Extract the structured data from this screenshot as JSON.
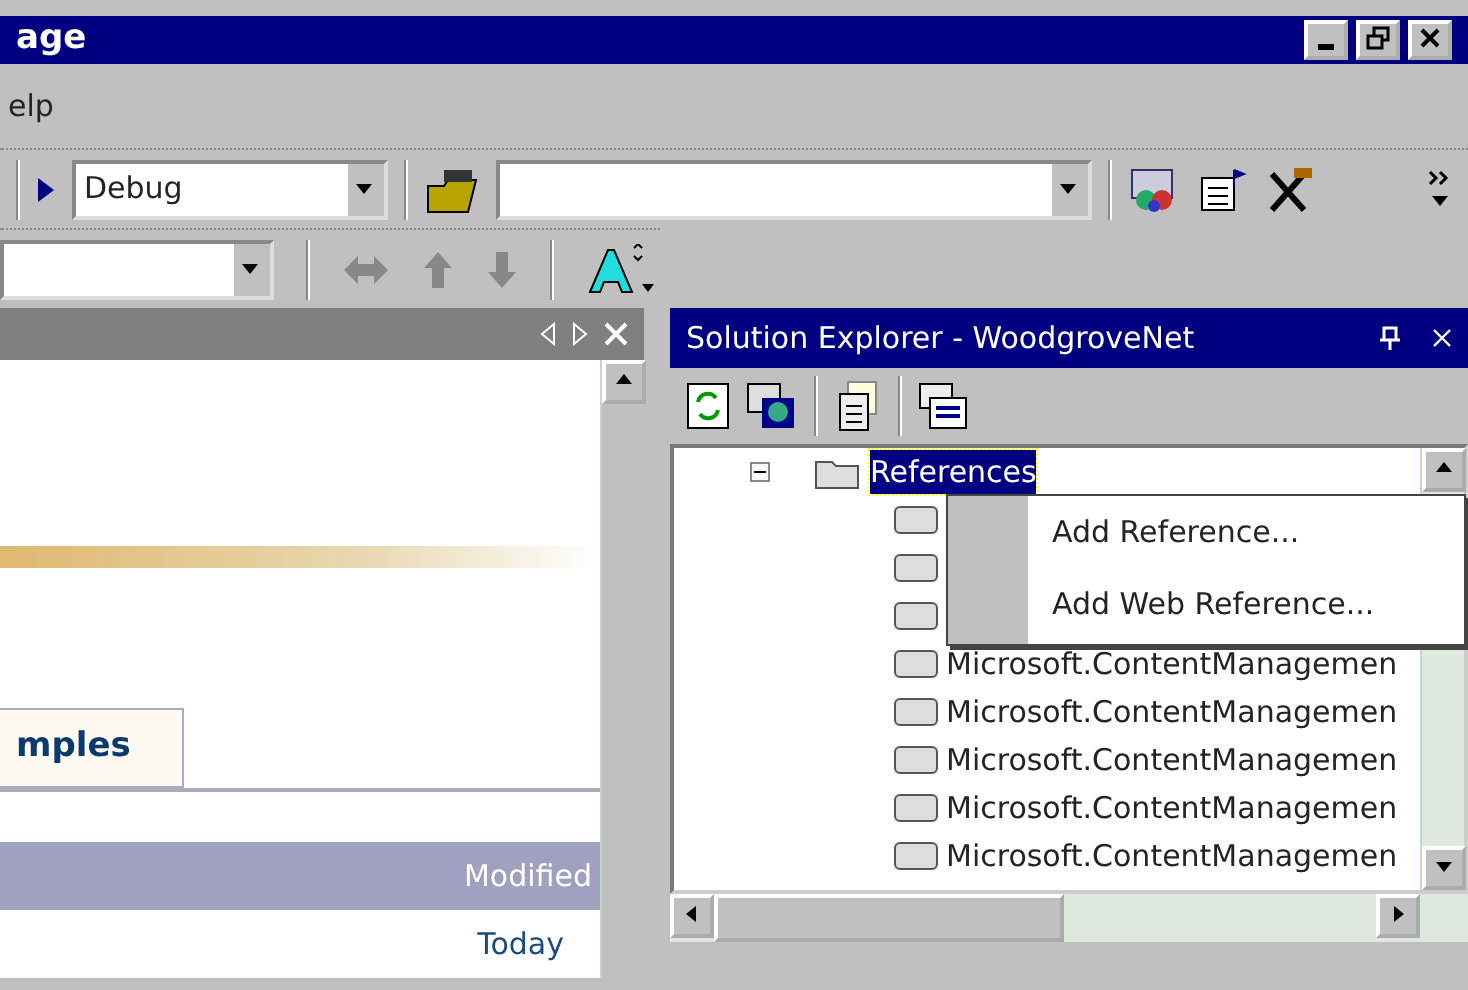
{
  "window": {
    "title": "age"
  },
  "menu": {
    "items": [
      "elp"
    ]
  },
  "toolbar": {
    "configuration": "Debug"
  },
  "editor": {
    "tab": "mples",
    "table": {
      "columns": [
        "Modified"
      ],
      "rows": [
        [
          "Today"
        ]
      ]
    }
  },
  "solution_explorer": {
    "title": "Solution Explorer - WoodgroveNet",
    "tree": {
      "label": "References",
      "expanded": true,
      "selected": true,
      "children": [
        {
          "kind": "reference"
        },
        {
          "kind": "reference"
        },
        {
          "kind": "reference"
        },
        {
          "kind": "reference",
          "label": "Microsoft.ContentManagemen"
        },
        {
          "kind": "reference",
          "label": "Microsoft.ContentManagemen"
        },
        {
          "kind": "reference",
          "label": "Microsoft.ContentManagemen"
        },
        {
          "kind": "reference",
          "label": "Microsoft.ContentManagemen"
        },
        {
          "kind": "reference",
          "label": "Microsoft.ContentManagemen"
        }
      ]
    }
  },
  "context_menu": {
    "items": [
      {
        "text": "Add Reference..."
      },
      {
        "text": "Add Web Reference..."
      }
    ]
  }
}
